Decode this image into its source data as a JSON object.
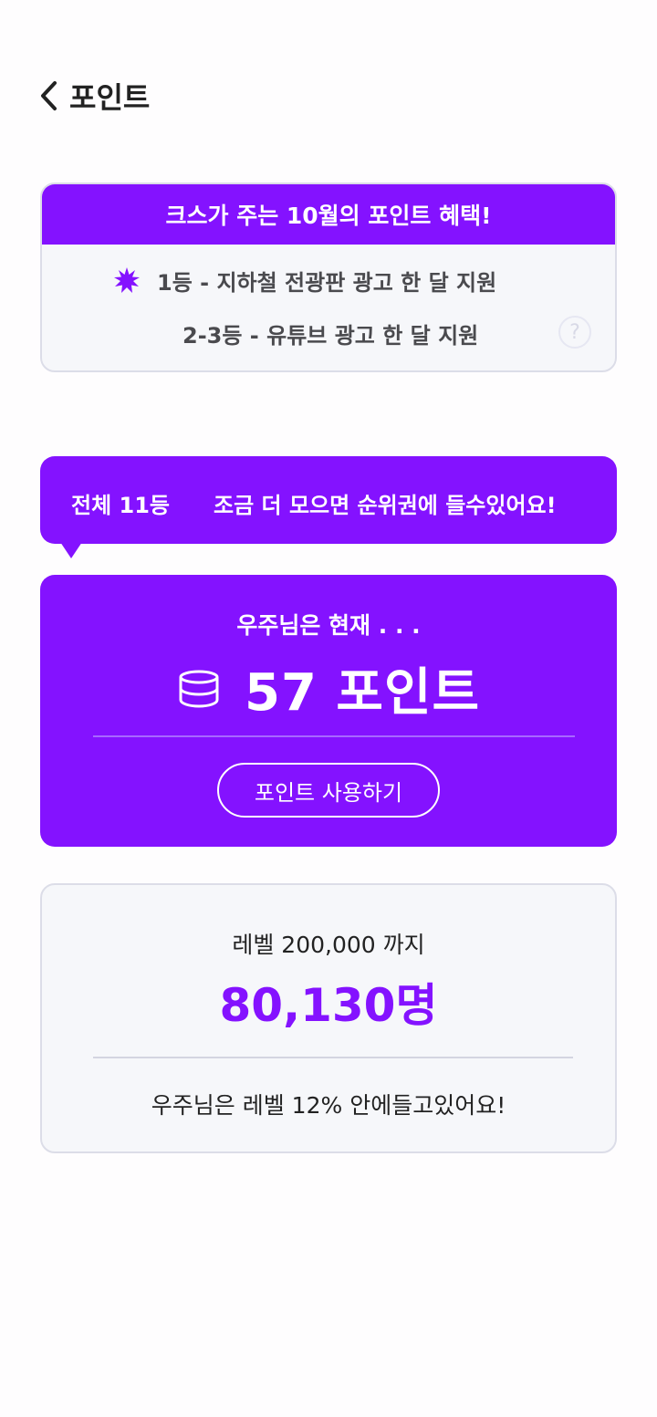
{
  "header": {
    "title": "포인트"
  },
  "benefit": {
    "title": "크스가 주는 10월의 포인트 혜택!",
    "items": [
      "1등 - 지하철 전광판 광고 한 달 지원",
      "2-3등 - 유튜브 광고 한 달 지원"
    ],
    "help_label": "?"
  },
  "rank": {
    "rank_label": "전체 11등",
    "message": "조금 더 모으면 순위권에 들수있어요!"
  },
  "points": {
    "current_label": "우주님은 현재 . . .",
    "amount": "57 포인트",
    "use_button": "포인트 사용하기"
  },
  "level": {
    "label": "레벨 200,000 까지",
    "count": "80,130명",
    "message": "우주님은 레벨 12% 안에들고있어요!"
  },
  "colors": {
    "accent": "#8412FF",
    "card_bg": "#F6F7FA",
    "border": "#DCDDE8"
  }
}
